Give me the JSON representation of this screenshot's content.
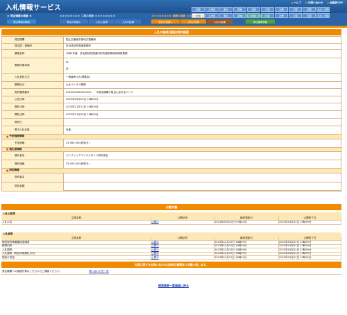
{
  "header": {
    "title": "入札情報サービス",
    "links": [
      "ヘルプ",
      "お問い合わせ",
      "全国版TOP"
    ],
    "regions_row1": [
      "全国",
      "北海道",
      "東北",
      "関東",
      "北陸",
      "中部",
      "近畿",
      "中国",
      "四国",
      "九州・沖縄"
    ],
    "regions_row2": [
      "全国",
      "北海道",
      "東北",
      "関東",
      "北陸",
      "中部",
      "近畿",
      "中国",
      "四国",
      "九州・沖縄"
    ],
    "selected_region": "全国",
    "categories": [
      {
        "label": "＊ 発注情報の検索 ＊",
        "tabs": [
          "発注情報の検索"
        ]
      },
      {
        "label": "＊＊＊＊＊＊＊＊ 工事の検索 ＊＊＊＊＊＊＊＊",
        "tabs": [
          "発注の見通し",
          "入札公告等",
          "入札の結果"
        ]
      },
      {
        "label": "＊＊＊＊＊＊＊＊ 業務の検索 ＊＊＊＊＊＊＊＊",
        "tabs": [
          "発注の見通し",
          "入札公告等",
          "入札の結果"
        ]
      },
      {
        "label": "＊＊ 発注機関の検索 ＊＊",
        "tabs": [
          "発注機関情報"
        ]
      }
    ]
  },
  "main": {
    "title": "入札の結果(業務)案件概要",
    "rows": [
      {
        "label": "発注機関",
        "value": "国土交通省中部地方整備局"
      },
      {
        "label": "発注部・事務所",
        "value": "多治見砂防国道事務所"
      },
      {
        "label": "業務名称",
        "value": "令和5年度　多治見砂防国道内砂防施設等維持補修業務"
      },
      {
        "label": "業務対象地域",
        "value": "市：\n区："
      },
      {
        "label": "入札契約方式",
        "value": "一般競争入札(標準型)"
      },
      {
        "label": "業務区分",
        "value": "土木コンサル業務"
      },
      {
        "label": "契約管理番号",
        "value": "2023053069920020　　※発注機関が独自に定めるコード"
      },
      {
        "label": "公告日時",
        "value": "2023年09月20日 10時00分"
      },
      {
        "label": "開札日時",
        "value": "2023年11月13日 10時00分"
      },
      {
        "label": "開札日時",
        "value": "2023年11月28日 10時00分"
      },
      {
        "label": "契約日",
        "value": ""
      },
      {
        "label": "電子入札対象",
        "value": "対象"
      }
    ],
    "yotei_header": "予定価格情報",
    "yotei": [
      {
        "label": "予定価格",
        "value": "43,580,000(税抜き)"
      }
    ],
    "rakusatsu_header": "落札者情報",
    "rakusatsu": [
      {
        "label": "落札者名",
        "value": "パシフィックコンサルタンツ株式会社"
      },
      {
        "label": "落札価格",
        "value": "35,000,000(税抜き)"
      }
    ],
    "keiyaku_header": "契約情報",
    "keiyaku": [
      {
        "label": "契約者名",
        "value": ""
      },
      {
        "label": "契約金額",
        "value": ""
      }
    ]
  },
  "publications": {
    "title": "公開文書",
    "koukoku_header": "入札公告等",
    "columns": [
      "文書名称",
      "公開状況",
      "最終更新日",
      "公開終了日"
    ],
    "koukoku_rows": [
      {
        "name": "入札公告",
        "status": "公開中",
        "updated": "2023年09月20日 07時44分",
        "end": "2023年03月31日 23時59分"
      }
    ],
    "kekka_header": "入札結果",
    "kekka_rows": [
      {
        "name": "随意契約等審議経過調書",
        "status": "公開中",
        "updated": "2023年12月15日 16時59分",
        "end": "2023年03月31日 23時59分"
      },
      {
        "name": "積算内訳",
        "status": "公開中",
        "updated": "2023年12月15日 16時59分",
        "end": "2023年03月31日 23時59分"
      },
      {
        "name": "入札調書",
        "status": "公開中",
        "updated": "2023年12月15日 16時59分",
        "end": "2023年03月31日 23時59分"
      },
      {
        "name": "入札調書（総合評価落札方式）",
        "status": "公開中",
        "updated": "2023年12月15日 16時59分",
        "end": "2023年03月31日 23時59分"
      },
      {
        "name": "契約の内容",
        "status": "公開中",
        "updated": "2023年12月15日 16時59分",
        "end": "2023年03月31日 23時59分"
      }
    ]
  },
  "inquiry": {
    "title": "内容に関するお問い合わせは各発注機関までお願い致します。",
    "text": "発注機関への連絡先等はこちらからご確認ください。",
    "link": "問い合わせ先一覧"
  },
  "back_link": "検索結果一覧画面に戻る",
  "colors": {
    "accent": "#f08a00",
    "header": "#1f4f8e",
    "label_bg": "#fff3cf",
    "link": "#1a3fb0"
  }
}
